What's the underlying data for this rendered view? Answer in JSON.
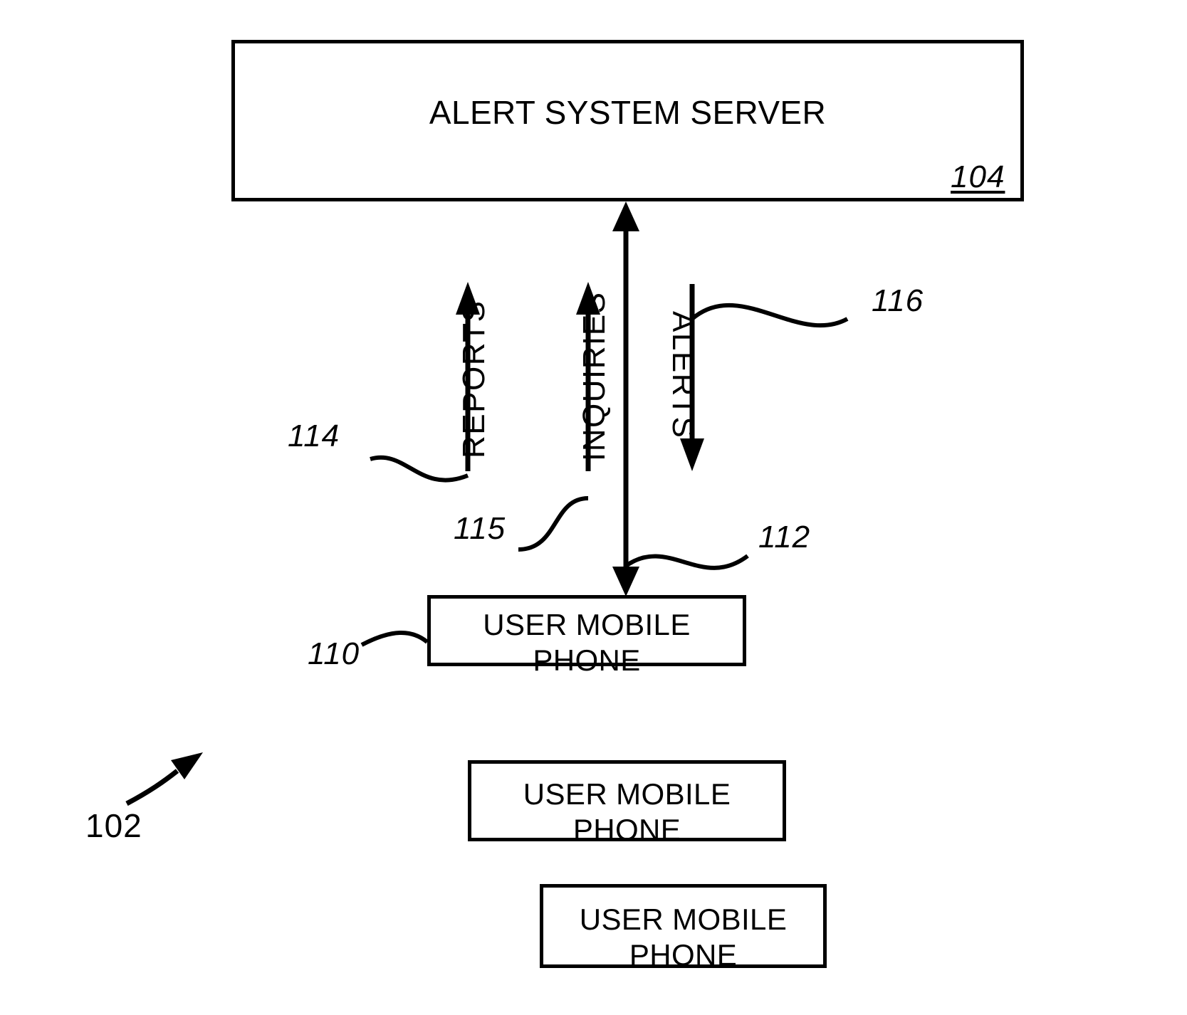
{
  "figure": {
    "figure_ref": "102",
    "nodes": [
      {
        "id": "server",
        "label": "ALERT SYSTEM SERVER",
        "ref": "104"
      },
      {
        "id": "phone1",
        "label": "USER MOBILE\nPHONE",
        "ref": "110"
      },
      {
        "id": "phone2",
        "label": "USER MOBILE\nPHONE",
        "ref": ""
      },
      {
        "id": "phone3",
        "label": "USER MOBILE\nPHONE",
        "ref": ""
      }
    ],
    "flows": [
      {
        "id": "reports",
        "label": "REPORTS",
        "ref": "114",
        "direction": "up"
      },
      {
        "id": "inquiries",
        "label": "INQUIRIES",
        "ref": "115",
        "direction": "up"
      },
      {
        "id": "alerts",
        "label": "ALERTS",
        "ref": "116",
        "direction": "down"
      },
      {
        "id": "link",
        "label": "",
        "ref": "112",
        "direction": "bidirectional"
      }
    ],
    "colors": {
      "stroke": "#000000",
      "background": "#ffffff"
    }
  }
}
